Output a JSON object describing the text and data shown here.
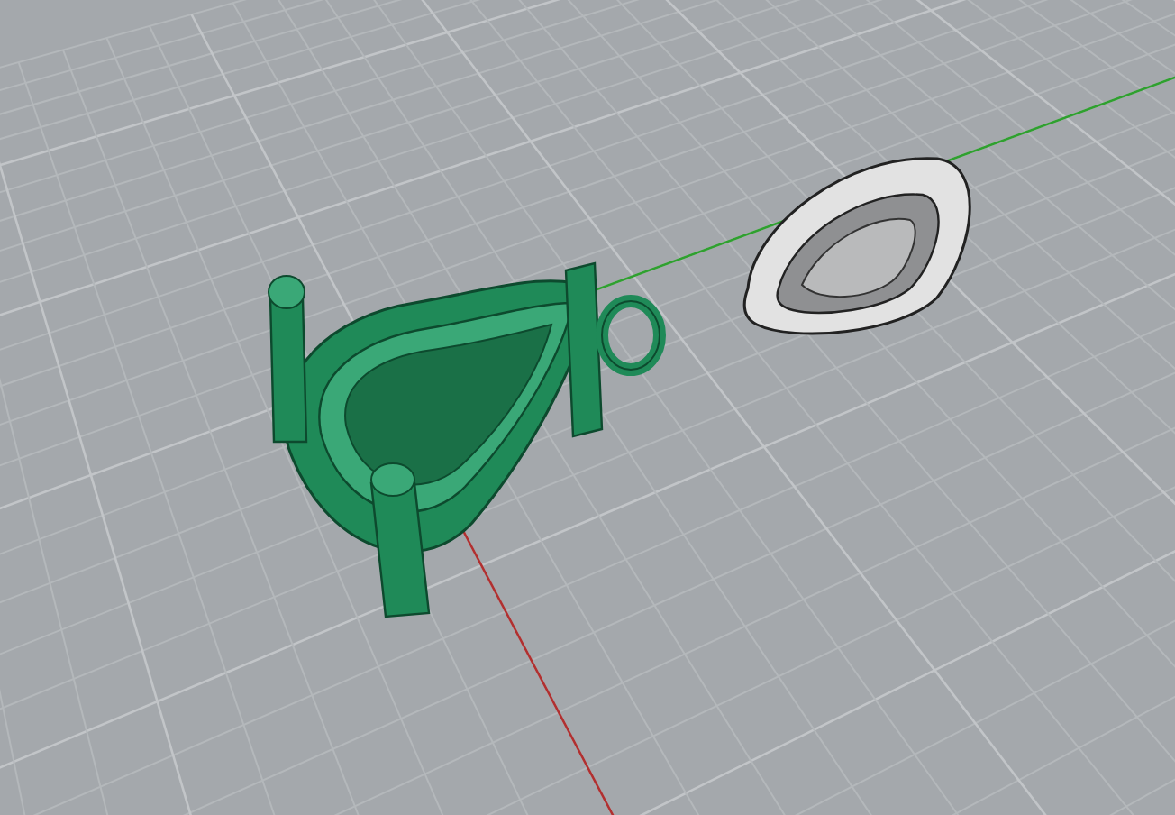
{
  "viewport": {
    "grid": true,
    "axes": true,
    "objects": [
      {
        "kind": "setting",
        "color": "#1f8a58"
      },
      {
        "kind": "bail",
        "color": "#e2e2e2"
      }
    ]
  }
}
